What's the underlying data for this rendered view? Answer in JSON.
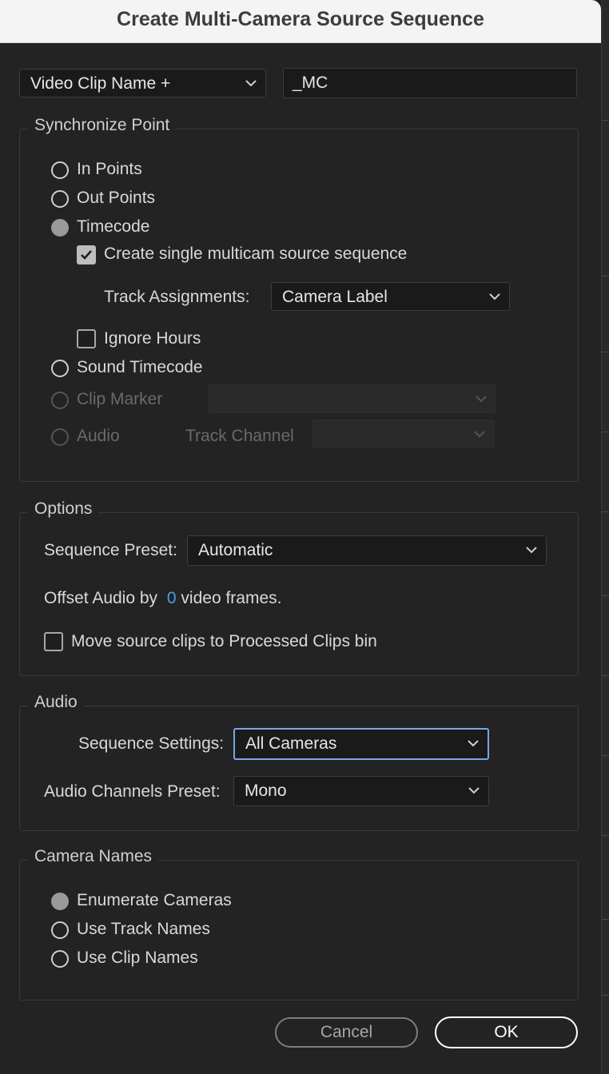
{
  "window": {
    "title": "Create Multi-Camera Source Sequence"
  },
  "name_row": {
    "clip_name_option": "Video Clip Name +",
    "suffix_value": "_MC"
  },
  "sync": {
    "legend": "Synchronize Point",
    "in_points": "In Points",
    "out_points": "Out Points",
    "timecode": "Timecode",
    "create_single": "Create single multicam source sequence",
    "track_assignments_label": "Track Assignments:",
    "track_assignments_value": "Camera Label",
    "ignore_hours": "Ignore Hours",
    "sound_timecode": "Sound Timecode",
    "clip_marker": "Clip Marker",
    "audio": "Audio",
    "track_channel_label": "Track Channel",
    "selected": "Timecode"
  },
  "options": {
    "legend": "Options",
    "sequence_preset_label": "Sequence Preset:",
    "sequence_preset_value": "Automatic",
    "offset_prefix": "Offset Audio by",
    "offset_value": "0",
    "offset_suffix": "video frames.",
    "move_source": "Move source clips to Processed Clips bin"
  },
  "audio": {
    "legend": "Audio",
    "sequence_settings_label": "Sequence Settings:",
    "sequence_settings_value": "All Cameras",
    "channels_preset_label": "Audio Channels Preset:",
    "channels_preset_value": "Mono"
  },
  "camera_names": {
    "legend": "Camera Names",
    "enumerate": "Enumerate Cameras",
    "use_track": "Use Track Names",
    "use_clip": "Use Clip Names",
    "selected": "Enumerate Cameras"
  },
  "buttons": {
    "cancel": "Cancel",
    "ok": "OK"
  },
  "colors": {
    "accent": "#4a9ff0",
    "focus_ring": "#78a6e0",
    "background": "#232323"
  }
}
